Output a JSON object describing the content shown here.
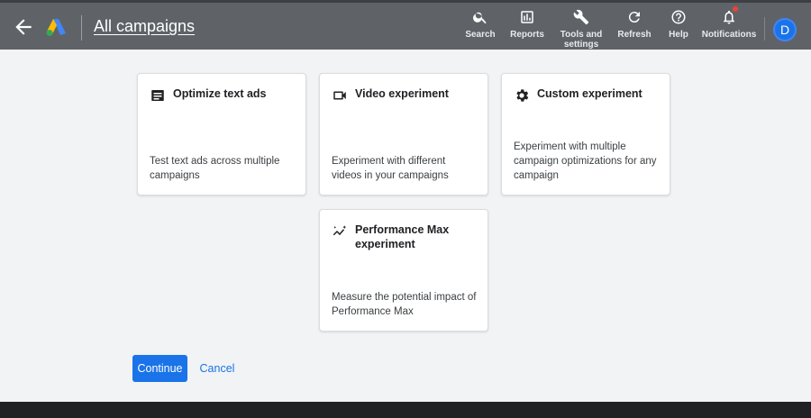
{
  "header": {
    "title": "All campaigns",
    "nav": [
      {
        "label": "Search",
        "icon": "search-icon"
      },
      {
        "label": "Reports",
        "icon": "reports-icon"
      },
      {
        "label": "Tools and settings",
        "icon": "wrench-icon"
      },
      {
        "label": "Refresh",
        "icon": "refresh-icon"
      },
      {
        "label": "Help",
        "icon": "help-icon"
      },
      {
        "label": "Notifications",
        "icon": "bell-icon"
      }
    ],
    "avatar_initial": "D"
  },
  "cards": [
    {
      "title": "Optimize text ads",
      "description": "Test text ads across multiple campaigns",
      "icon": "text-ads-icon"
    },
    {
      "title": "Video experiment",
      "description": "Experiment with different videos in your campaigns",
      "icon": "video-camera-icon"
    },
    {
      "title": "Custom experiment",
      "description": "Experiment with multiple campaign optimizations for any campaign",
      "icon": "gear-icon"
    },
    {
      "title": "Performance Max experiment",
      "description": "Measure the potential impact of Performance Max",
      "icon": "performance-sparkle-icon"
    }
  ],
  "actions": {
    "continue_label": "Continue",
    "cancel_label": "Cancel"
  },
  "colors": {
    "accent": "#1a73e8",
    "header_bg": "#5f6368",
    "page_bg": "#f1f3f4",
    "notification_dot": "#ea4335"
  }
}
